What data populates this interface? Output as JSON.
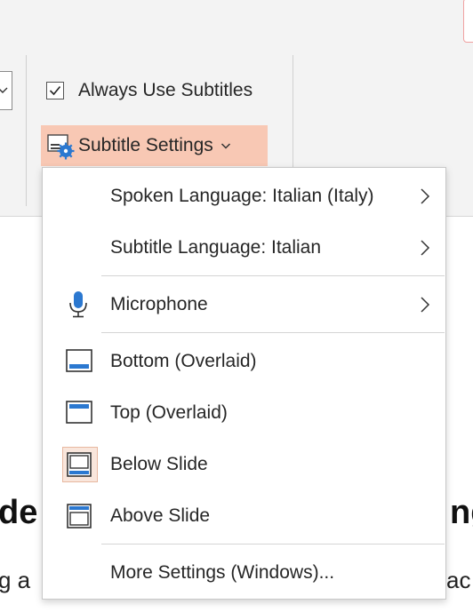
{
  "ribbon": {
    "always_use_subtitles": {
      "label": "Always Use Subtitles",
      "checked": true
    },
    "subtitle_settings": {
      "label": "Subtitle Settings",
      "chevron": "chevron-down-icon"
    }
  },
  "menu": {
    "spoken_language": {
      "label": "Spoken Language: Italian (Italy)",
      "arrow": "chevron-right-icon"
    },
    "subtitle_language": {
      "label": "Subtitle Language: Italian",
      "arrow": "chevron-right-icon"
    },
    "microphone": {
      "label": "Microphone",
      "icon": "microphone-icon",
      "arrow": "chevron-right-icon"
    },
    "bottom_overlaid": {
      "label": "Bottom (Overlaid)",
      "icon": "bottom-overlaid-icon"
    },
    "top_overlaid": {
      "label": "Top (Overlaid)",
      "icon": "top-overlaid-icon"
    },
    "below_slide": {
      "label": "Below Slide",
      "icon": "below-slide-icon",
      "selected": true
    },
    "above_slide": {
      "label": "Above Slide",
      "icon": "above-slide-icon"
    },
    "more_settings": {
      "label": "More Settings (Windows)..."
    }
  },
  "document": {
    "heading_left": "de",
    "heading_right": "ng",
    "line_left": "g a",
    "line_right": "ac"
  },
  "colors": {
    "accent_blue": "#2b78d0",
    "highlight": "#f8c8b4",
    "ribbon_bg": "#f3f3f3"
  }
}
